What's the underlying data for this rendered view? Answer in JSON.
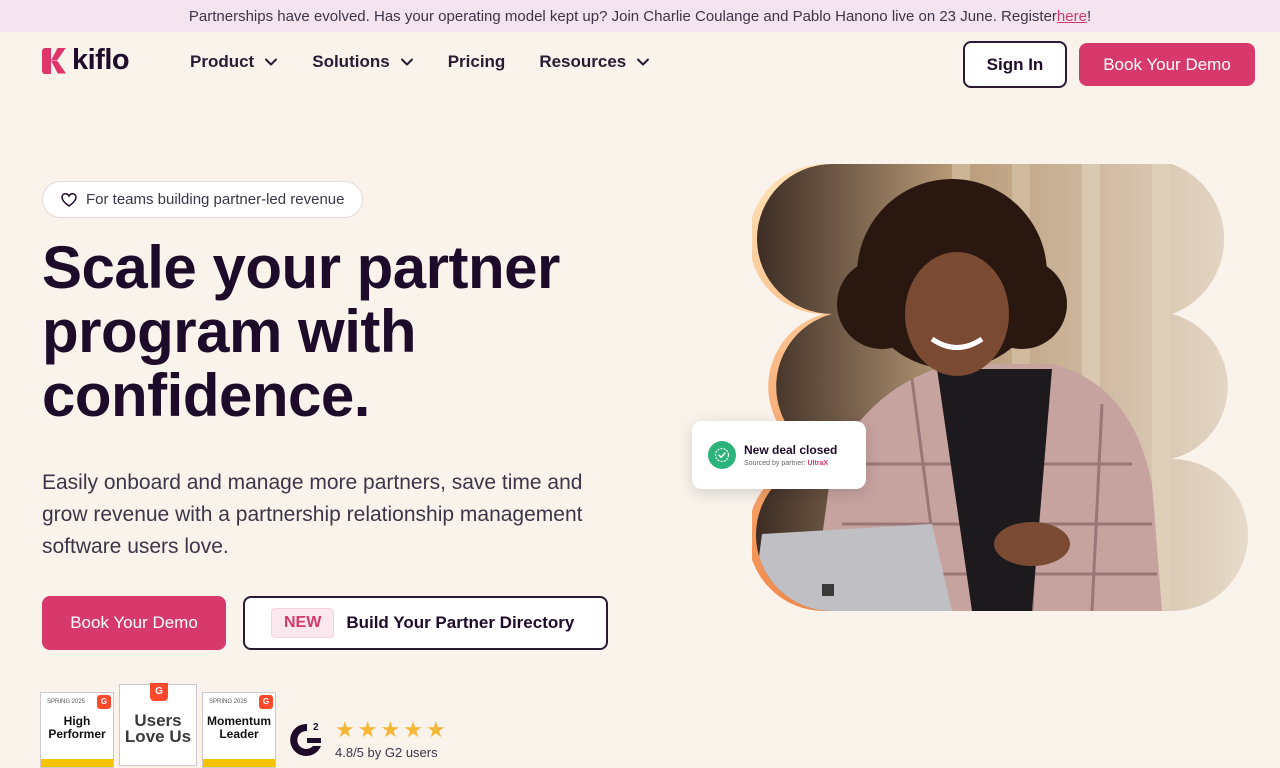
{
  "announcement": {
    "text": "Partnerships have evolved. Has your operating model kept up? Join Charlie Coulange and Pablo Hanono live on 23 June. Register ",
    "link": "here",
    "suffix": "!"
  },
  "brand": {
    "name": "kiflo",
    "accent": "#d7396d"
  },
  "nav": {
    "items": [
      {
        "label": "Product",
        "dropdown": true
      },
      {
        "label": "Solutions",
        "dropdown": true
      },
      {
        "label": "Pricing",
        "dropdown": false
      },
      {
        "label": "Resources",
        "dropdown": true
      }
    ],
    "signin": "Sign In",
    "demo": "Book Your Demo"
  },
  "hero": {
    "tag": "For teams building partner-led revenue",
    "headline_lines": [
      "Scale your partner",
      "program with",
      "confidence."
    ],
    "subtext_lines": [
      "Easily onboard and manage more partners, save time and",
      "grow revenue with a partnership relationship management",
      "software users love."
    ],
    "cta_primary": "Book Your Demo",
    "cta_secondary_badge": "NEW",
    "cta_secondary": "Build Your Partner Directory"
  },
  "badges": [
    {
      "season": "SPRING 2025",
      "title_lines": [
        "High",
        "Performer"
      ]
    },
    {
      "title_lines": [
        "Users",
        "Love Us"
      ]
    },
    {
      "season": "SPRING 2025",
      "title_lines": [
        "Momentum",
        "Leader"
      ]
    }
  ],
  "rating": {
    "stars": 5,
    "text": "4.8/5 by G2 users"
  },
  "deal_card": {
    "title": "New deal closed",
    "sub_prefix": "Sourced by partner: ",
    "partner": "UltraX"
  }
}
